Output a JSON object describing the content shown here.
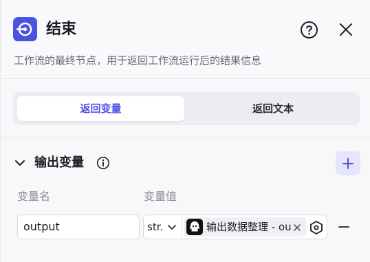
{
  "node": {
    "title": "结束",
    "description": "工作流的最终节点，用于返回工作流运行后的结果信息",
    "icon": "end-node-icon",
    "accent_color": "#4b53e0"
  },
  "tabs": [
    {
      "label": "返回变量",
      "active": true
    },
    {
      "label": "返回文本",
      "active": false
    }
  ],
  "output_section": {
    "title": "输出变量",
    "column_name": "变量名",
    "column_value": "变量值",
    "rows": [
      {
        "name": "output",
        "type": "str.",
        "reference": "输出数据整理 - output"
      }
    ]
  }
}
